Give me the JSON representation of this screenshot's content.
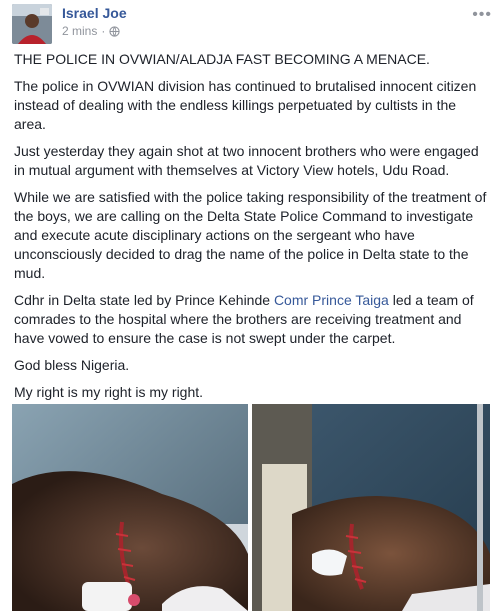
{
  "post": {
    "author": "Israel Joe",
    "time": "2 mins",
    "more_icon": "more-options-icon",
    "paragraphs": {
      "p1": "THE POLICE IN OVWIAN/ALADJA FAST BECOMING A MENACE.",
      "p2": "The police in OVWIAN division has continued to brutalised innocent citizen instead of dealing with the endless killings perpetuated by cultists in the area.",
      "p3": "Just yesterday they again shot at two innocent brothers who were engaged in mutual argument with themselves at Victory View hotels, Udu Road.",
      "p4": "While we are satisfied with the police taking responsibility of the treatment of the boys, we are calling on the Delta State Police Command to investigate and execute acute disciplinary actions on the sergeant who have unconsciously decided to drag the name of the police in Delta state to the mud.",
      "p5_before": "Cdhr in Delta state led by Prince Kehinde ",
      "p5_link": "Comr Prince Taiga",
      "p5_after": " led a team of comrades to the hospital where the brothers are receiving treatment and have vowed to ensure the case is not swept under the carpet.",
      "p6": "God bless Nigeria.",
      "p7": "My right is my right is my right."
    }
  },
  "colors": {
    "author_link": "#365899",
    "meta_gray": "#90949c",
    "text": "#1d2129"
  }
}
